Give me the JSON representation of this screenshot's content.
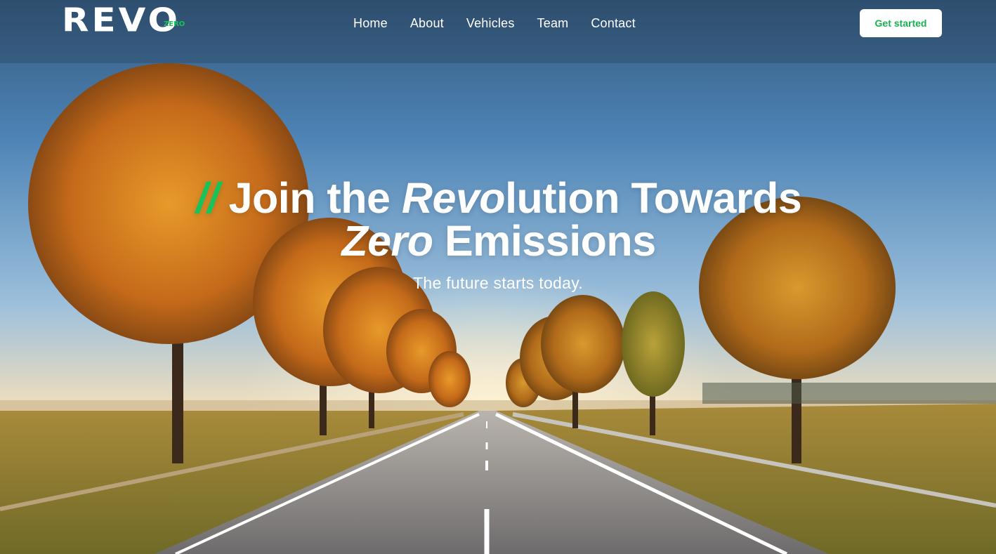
{
  "brand": {
    "logo_text": "REVO",
    "logo_badge": "ZERO",
    "accent_color": "#19c35b"
  },
  "nav": {
    "items": [
      {
        "label": "Home"
      },
      {
        "label": "About"
      },
      {
        "label": "Vehicles"
      },
      {
        "label": "Team"
      },
      {
        "label": "Contact"
      }
    ],
    "cta_label": "Get started"
  },
  "hero": {
    "slashes": "//",
    "title_part1": "Join the ",
    "title_italic1": "Revo",
    "title_part2": "lution Towards",
    "title_italic2": "Zero",
    "title_part3": " Emissions",
    "subtitle": "The future starts today.",
    "background": "autumn-road-photo"
  }
}
